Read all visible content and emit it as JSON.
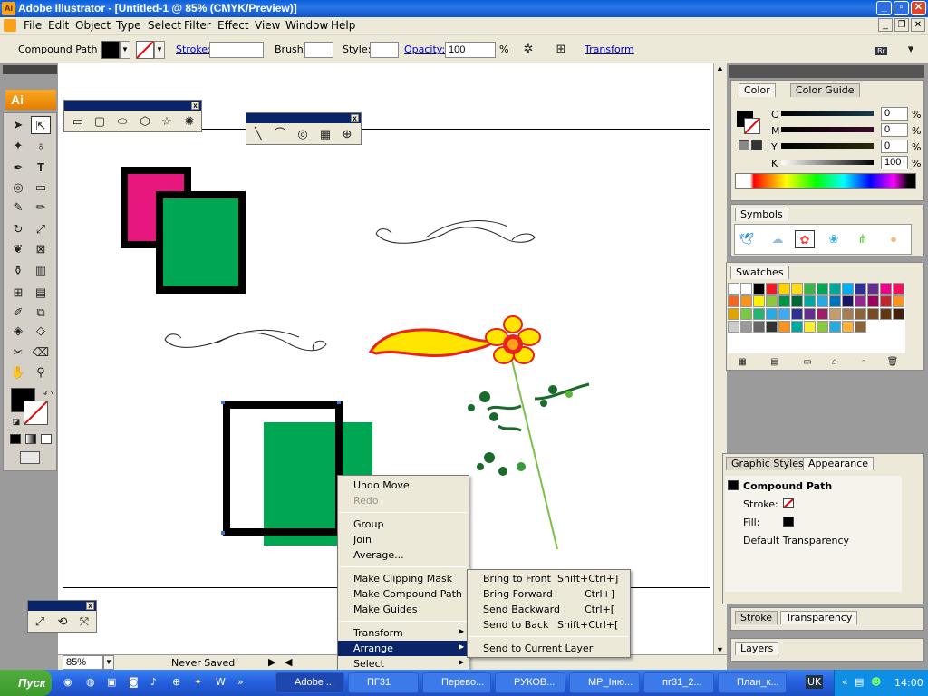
{
  "app": {
    "title": "Adobe Illustrator - [Untitled-1 @ 85% (CMYK/Preview)]",
    "logo": "Ai"
  },
  "menu": [
    "File",
    "Edit",
    "Object",
    "Type",
    "Select",
    "Filter",
    "Effect",
    "View",
    "Window",
    "Help"
  ],
  "control": {
    "selection": "Compound Path",
    "stroke_label": "Stroke:",
    "brush_label": "Brush:",
    "style_label": "Style:",
    "opacity_label": "Opacity:",
    "opacity_value": "100",
    "percent": "%",
    "transform_label": "Transform",
    "br_label": "Br"
  },
  "status": {
    "zoom": "85%",
    "save_state": "Never Saved"
  },
  "context_menu": {
    "items": [
      "Undo Move",
      "Redo",
      "Group",
      "Join",
      "Average...",
      "Make Clipping Mask",
      "Make Compound Path",
      "Make Guides",
      "Transform",
      "Arrange",
      "Select"
    ],
    "disabled": "Redo",
    "highlighted": "Arrange"
  },
  "arrange_submenu": {
    "items": [
      {
        "label": "Bring to Front",
        "shortcut": "Shift+Ctrl+]"
      },
      {
        "label": "Bring Forward",
        "shortcut": "Ctrl+]"
      },
      {
        "label": "Send Backward",
        "shortcut": "Ctrl+["
      },
      {
        "label": "Send to Back",
        "shortcut": "Shift+Ctrl+["
      },
      {
        "label": "Send to Current Layer",
        "shortcut": ""
      }
    ]
  },
  "panels": {
    "color": {
      "tabs": [
        "Color",
        "Color Guide"
      ],
      "channels": [
        {
          "name": "C",
          "value": "0"
        },
        {
          "name": "M",
          "value": "0"
        },
        {
          "name": "Y",
          "value": "0"
        },
        {
          "name": "K",
          "value": "100"
        }
      ],
      "unit": "%"
    },
    "symbols": {
      "tab": "Symbols"
    },
    "swatches": {
      "tab": "Swatches",
      "colors": [
        "#ffffff",
        "#ffffff",
        "#000000",
        "#ed1c24",
        "#ffd200",
        "#ffde17",
        "#39b54a",
        "#00a651",
        "#00a99d",
        "#00aeef",
        "#2e3192",
        "#662d91",
        "#ec008c",
        "#ed145b",
        "#f26522",
        "#f7941d",
        "#fff200",
        "#8dc63f",
        "#009245",
        "#006837",
        "#00a99d",
        "#27aae1",
        "#0072bc",
        "#1b1464",
        "#92278f",
        "#9e005d",
        "#c1272d",
        "#f7931e",
        "#e2a300",
        "#7ac943",
        "#22b573",
        "#29abe2",
        "#3fa9f5",
        "#2e3192",
        "#662d91",
        "#9e1f63",
        "#c69c6d",
        "#a67c52",
        "#8c6239",
        "#754c24",
        "#603813",
        "#42210b",
        "#cccccc",
        "#999999",
        "#666666",
        "#333333",
        "#f7941d",
        "#00a99d",
        "#f9ed32",
        "#8cc63f",
        "#29abe2",
        "#fbb03b",
        "#8c6239"
      ]
    },
    "appearance": {
      "tabs": [
        "Graphic Styles",
        "Appearance"
      ],
      "title": "Compound Path",
      "rows": [
        "Stroke:",
        "Fill:",
        "Default Transparency"
      ]
    },
    "stroke_tabs": [
      "Stroke",
      "Transparency"
    ],
    "layers": {
      "tab": "Layers"
    }
  },
  "taskbar": {
    "start": "Пуск",
    "tasks": [
      "Adobe ...",
      "ПГ31",
      "Перево...",
      "РУКОВ...",
      "МР_Іню...",
      "пг31_2...",
      "План_к..."
    ],
    "lang": "UK",
    "clock": "14:00"
  }
}
